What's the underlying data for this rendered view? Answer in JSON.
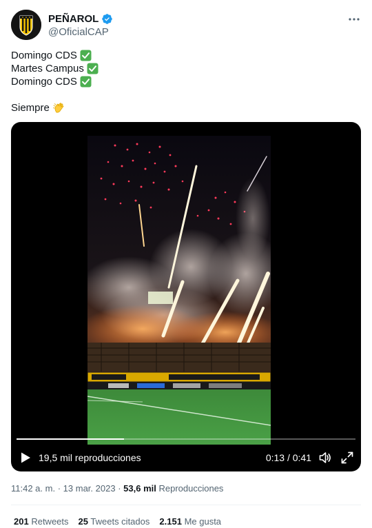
{
  "author": {
    "display_name": "PEÑAROL",
    "handle": "@OficialCAP",
    "avatar": "penarol-crest",
    "verified": true
  },
  "tweet": {
    "lines": [
      "Domingo CDS",
      "Martes Campus",
      "Domingo CDS"
    ],
    "line_emoji": "white-heavy-check-mark",
    "closing": "Siempre",
    "closing_emoji": "clapping-hands"
  },
  "video": {
    "views": "19,5 mil reproducciones",
    "time": "0:13 / 0:41",
    "progress": 0.317
  },
  "meta": {
    "time": "11:42 a. m.",
    "separator": "·",
    "date": "13 mar. 2023",
    "views_count": "53,6 mil",
    "views_label": "Reproducciones"
  },
  "stats": {
    "retweets_count": "201",
    "retweets_label": "Retweets",
    "quotes_count": "25",
    "quotes_label": "Tweets citados",
    "likes_count": "2.151",
    "likes_label": "Me gusta"
  },
  "colors": {
    "text": "#0f1419",
    "secondary": "#536471",
    "verified": "#1d9bf0",
    "check_green": "#4caf50",
    "penarol_gold": "#f5c400"
  }
}
